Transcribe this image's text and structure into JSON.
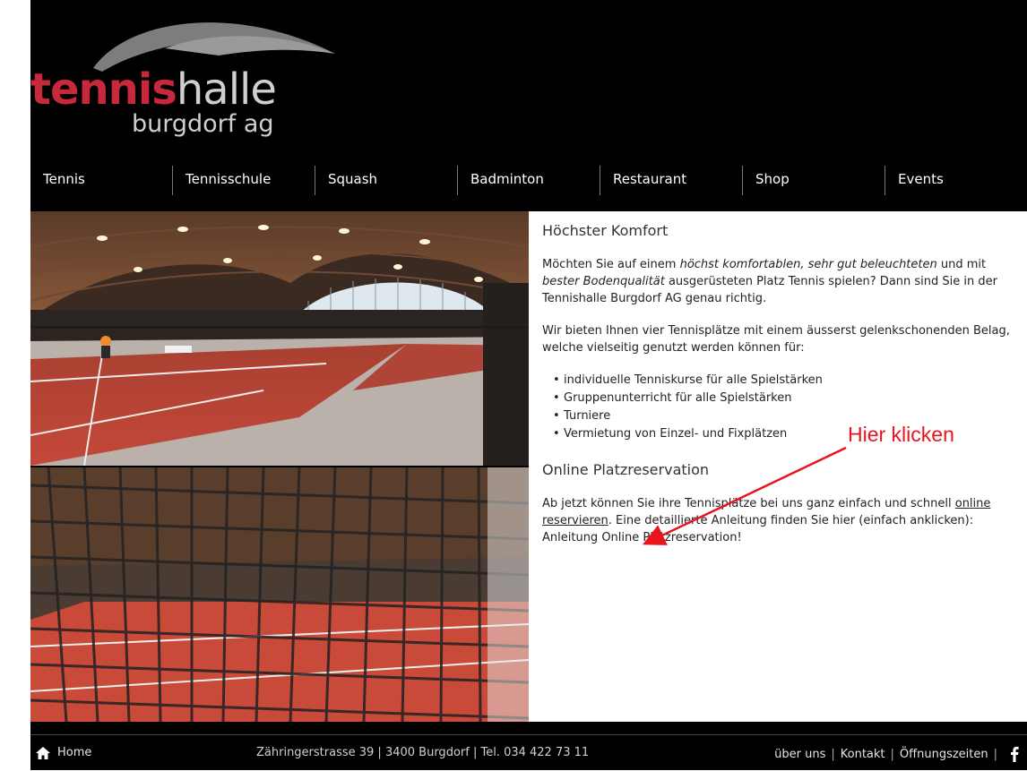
{
  "brand": {
    "bold": "tennis",
    "light": "halle",
    "sub": "burgdorf ag",
    "colors": {
      "red": "#c8283c",
      "gray": "#cfcfcf"
    }
  },
  "nav": {
    "items": [
      {
        "label": "Tennis"
      },
      {
        "label": "Tennisschule"
      },
      {
        "label": "Squash"
      },
      {
        "label": "Badminton"
      },
      {
        "label": "Restaurant"
      },
      {
        "label": "Shop"
      },
      {
        "label": "Events"
      }
    ]
  },
  "content": {
    "title1": "Höchster Komfort",
    "para1": {
      "t1": "Möchten Sie auf einem ",
      "em1": "höchst komfortablen, sehr gut beleuchteten",
      "t2": " und mit ",
      "em2": "bester Bodenqualität",
      "t3": " ausgerüsteten Platz Tennis spielen? Dann sind Sie in der Tennishalle Burgdorf AG genau richtig."
    },
    "para2": "Wir bieten Ihnen vier Tennisplätze mit einem äusserst gelenkschonenden Belag, welche vielseitig genutzt werden können für:",
    "list": [
      "individuelle Tenniskurse für alle Spielstärken",
      "Gruppenunterricht für alle Spielstärken",
      "Turniere",
      "Vermietung von Einzel- und Fixplätzen"
    ],
    "title2": "Online Platzreservation",
    "para3": {
      "t1": "Ab jetzt können Sie ihre Tennisplätze bei uns ganz einfach und schnell ",
      "link": "online reservieren",
      "t2": ". Eine detaillierte Anleitung finden Sie hier (einfach anklicken): Anleitung Online Platzreservation!"
    }
  },
  "annotation": {
    "text": "Hier klicken",
    "color": "#e8141e"
  },
  "footer": {
    "home": "Home",
    "address": "Zähringerstrasse 39  |  3400 Burgdorf  |  Tel. 034 422 73 11",
    "links": [
      "über uns",
      "Kontakt",
      "Öffnungszeiten"
    ],
    "icons": [
      "home-icon",
      "facebook-icon"
    ]
  }
}
